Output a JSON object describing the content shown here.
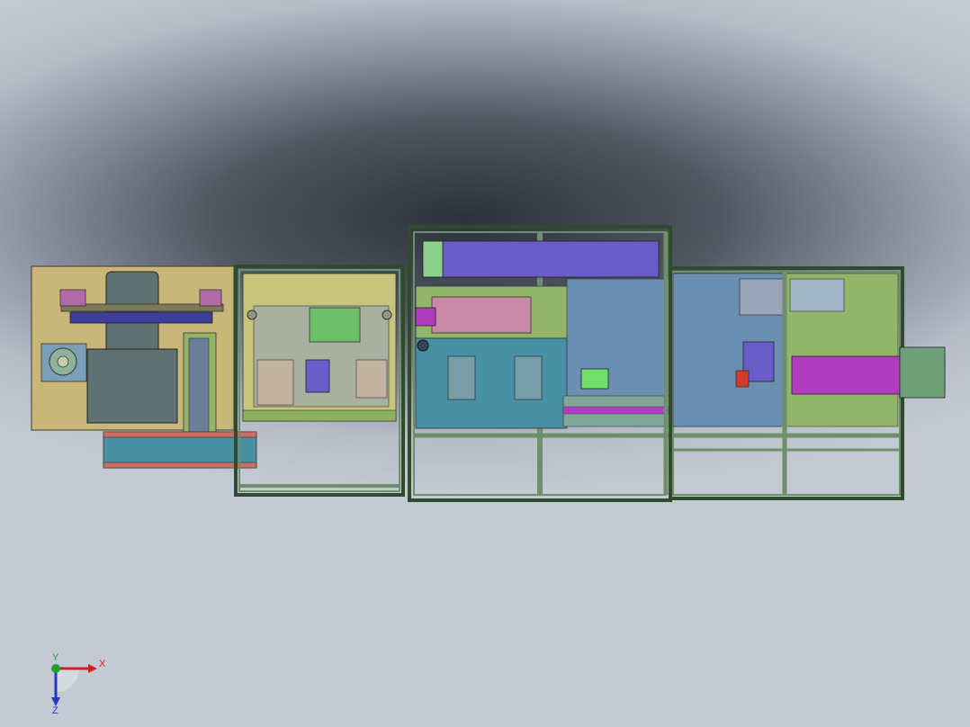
{
  "app": {
    "view": "top-view"
  },
  "triad": {
    "x_label": "X",
    "y_label": "Y",
    "z_label": "Z",
    "x_color": "#d42020",
    "y_color": "#1fa32a",
    "z_color": "#2438c8"
  },
  "palette": {
    "frame": "#6f8f6c",
    "frame_edge": "#2f4a2c",
    "plate_yellow": "#c8c47a",
    "plate_tan": "#c9b679",
    "plate_teal": "#4a90a4",
    "plate_blue": "#6b8fb0",
    "plate_green": "#93b56a",
    "part_purple": "#6a5cc9",
    "part_magenta": "#b03cc0",
    "part_pink": "#c98aa8",
    "part_red": "#d33a2a",
    "part_slate": "#5f7272"
  }
}
